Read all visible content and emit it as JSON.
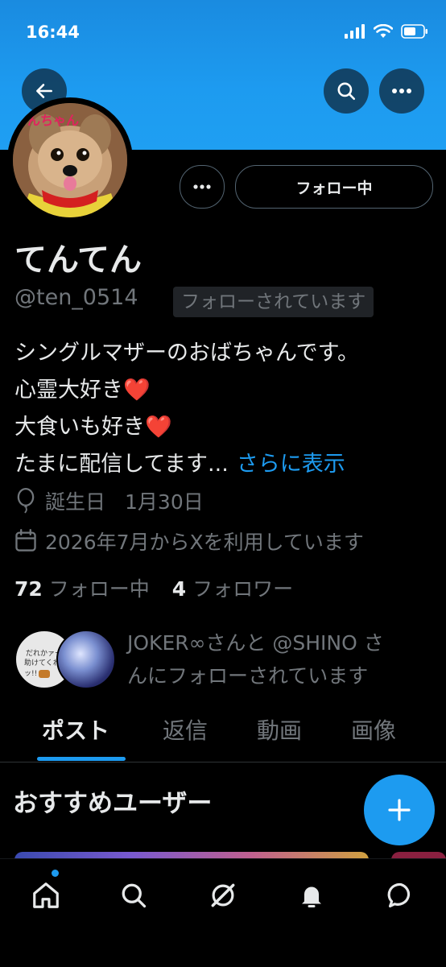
{
  "status_bar": {
    "time": "16:44"
  },
  "header": {
    "avatar_label": "んちゃん"
  },
  "profile": {
    "display_name": "てんてん",
    "handle": "@ten_0514",
    "follows_you_badge": "フォローされています",
    "follow_button_label": "フォロー中",
    "bio_lines": [
      "シングルマザーのおばちゃんです。",
      "心霊大好き",
      "大食いも好き",
      "たまに配信してます..."
    ],
    "bio_heart": "❤️",
    "show_more": "さらに表示",
    "birthday_label": "誕生日",
    "birthday_value": "1月30日",
    "joined": "2026年7月からXを利用しています",
    "following_count": "72",
    "following_label": "フォロー中",
    "followers_count": "4",
    "followers_label": "フォロワー",
    "mutual_text_line1": "JOKER∞さんと @SHINO さ",
    "mutual_text_line2": "んにフォローされています",
    "mutual_avatar1_text1": "だれかァー!!",
    "mutual_avatar1_text2": "助けてくれーッ!!"
  },
  "tabs": [
    {
      "label": "ポスト",
      "active": true
    },
    {
      "label": "返信",
      "active": false
    },
    {
      "label": "動画",
      "active": false
    },
    {
      "label": "画像",
      "active": false
    }
  ],
  "section_title": "おすすめユーザー",
  "icons": {
    "back": "arrow-left-icon",
    "search": "search-icon",
    "more": "more-icon",
    "fab": "plus-icon",
    "nav": [
      "home-icon",
      "search-icon",
      "grok-icon",
      "bell-icon",
      "message-icon"
    ]
  },
  "colors": {
    "accent": "#1d9bf0",
    "secondary_text": "#71767b",
    "heart": "#e0245e"
  }
}
